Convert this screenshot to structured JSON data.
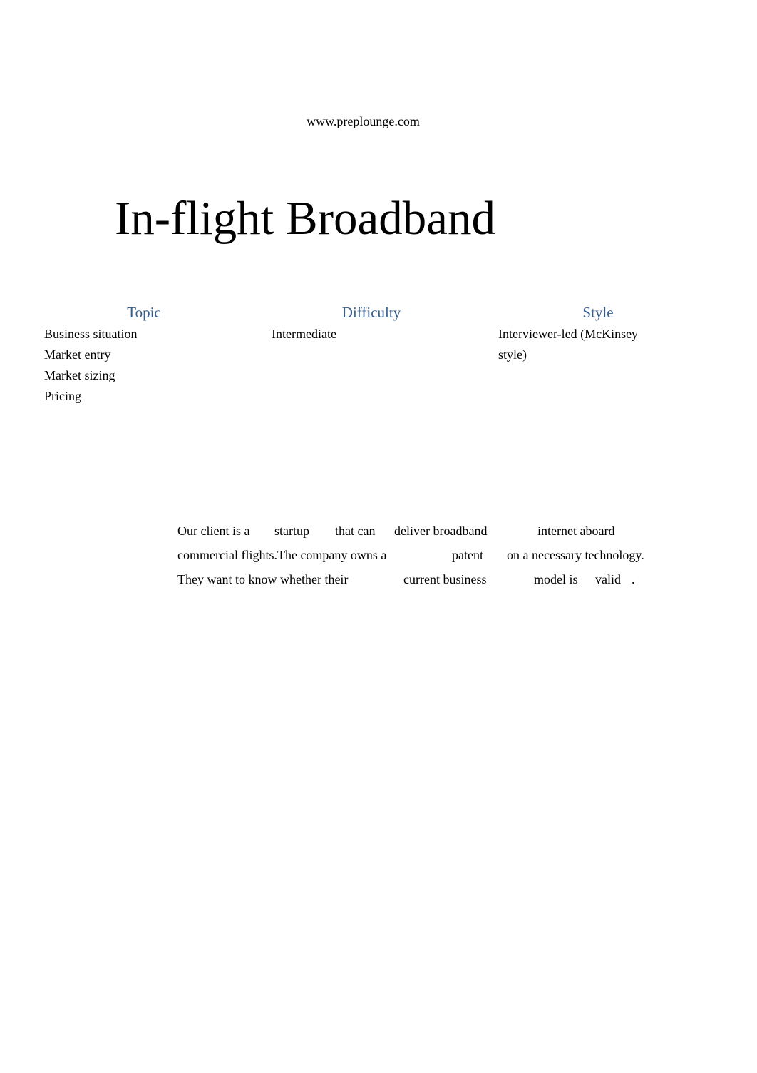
{
  "header": {
    "site_url": "www.preplounge.com"
  },
  "document": {
    "title": "In-flight Broadband"
  },
  "meta": {
    "topic": {
      "heading": "Topic",
      "items": [
        "Business situation",
        "Market entry",
        "Market sizing",
        "Pricing"
      ]
    },
    "difficulty": {
      "heading": "Difficulty",
      "items": [
        "Intermediate"
      ]
    },
    "style": {
      "heading": "Style",
      "items": [
        "Interviewer-led (McKinsey",
        "style)"
      ]
    },
    "heading_color": "#365f8d"
  },
  "intro": {
    "full_text": "Our client is a startup that can deliver broadband internet aboard commercial flights.The company owns a patent on a necessary technology. They want to know whether their current business model is valid .",
    "lines": [
      [
        "Our client is a",
        "startup",
        "that can",
        "deliver broadband",
        "internet aboard"
      ],
      [
        "commercial flights.The company owns a",
        "patent",
        "on a necessary technology."
      ],
      [
        "They want to know whether their",
        "current business",
        "model is",
        "valid",
        "."
      ]
    ]
  }
}
